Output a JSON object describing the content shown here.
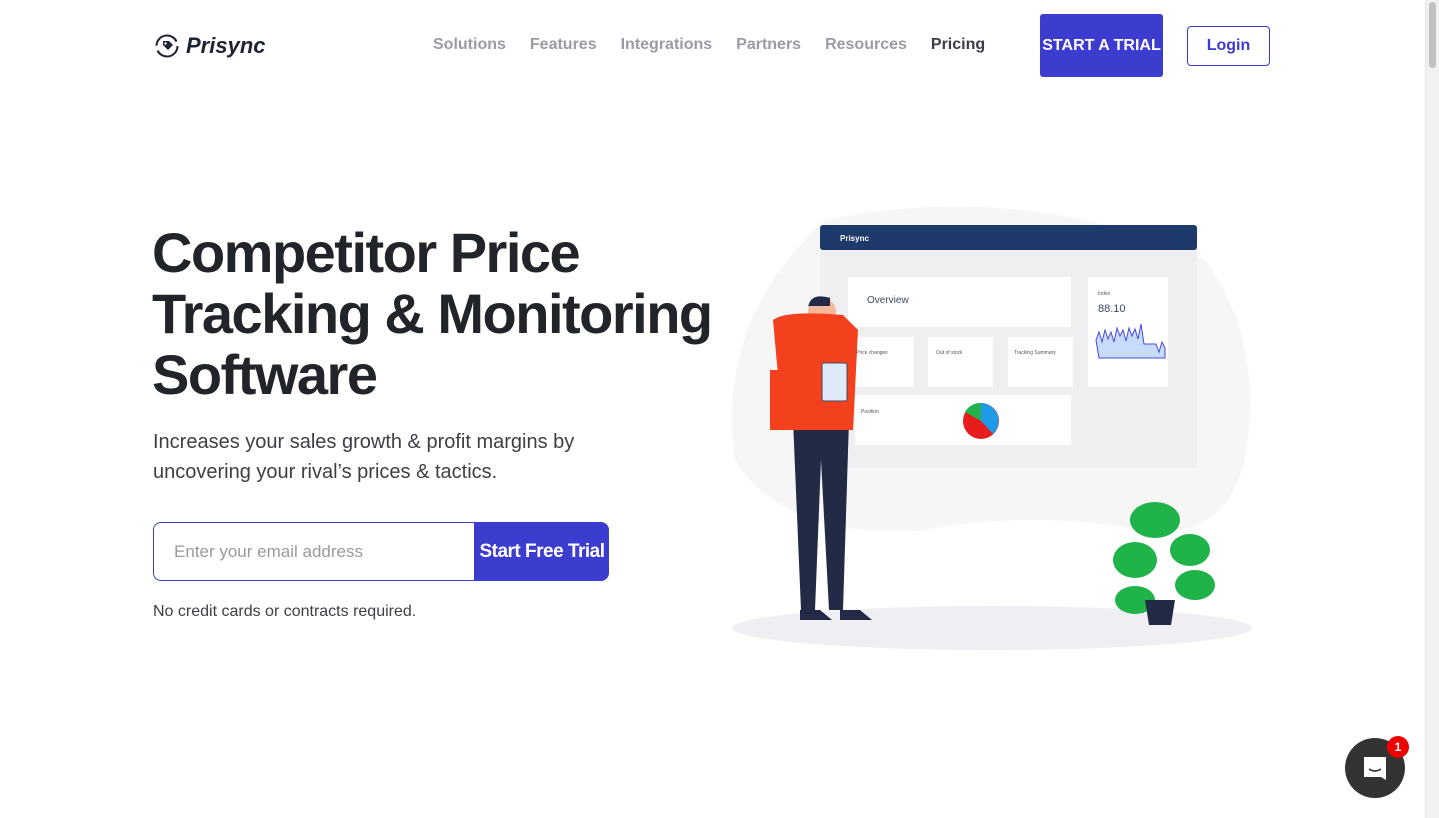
{
  "header": {
    "brand": "Prisync",
    "nav": [
      {
        "label": "Solutions"
      },
      {
        "label": "Features"
      },
      {
        "label": "Integrations"
      },
      {
        "label": "Partners"
      },
      {
        "label": "Resources"
      },
      {
        "label": "Pricing"
      }
    ],
    "trial_label": "START A TRIAL",
    "login_label": "Login"
  },
  "hero": {
    "title": "Competitor Price Tracking & Monitoring Software",
    "subtitle": "Increases your sales growth & profit margins by uncovering your rival’s prices & tactics.",
    "email_placeholder": "Enter your email address",
    "cta_label": "Start Free Trial",
    "note": "No credit cards or contracts required."
  },
  "illustration": {
    "brand": "Prisync",
    "overview": "Overview",
    "index_label": "Index",
    "index_value": "88.10",
    "cards": [
      "Price changes",
      "Out of stock",
      "Tracking Summary"
    ],
    "position": "Position"
  },
  "chat": {
    "badge": "1"
  },
  "colors": {
    "accent": "#3c3ccf",
    "dashboard_header": "#1e3a6b"
  }
}
